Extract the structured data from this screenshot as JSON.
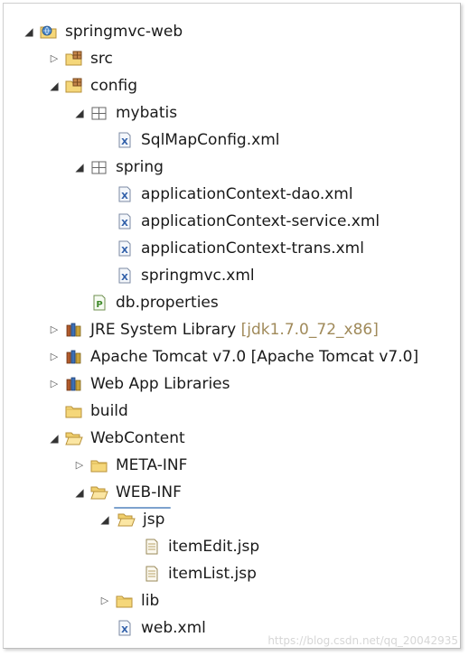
{
  "tree": {
    "items": [
      {
        "label": "springmvc-web"
      },
      {
        "label": "src"
      },
      {
        "label": "config"
      },
      {
        "label": "mybatis"
      },
      {
        "label": "SqlMapConfig.xml"
      },
      {
        "label": "spring"
      },
      {
        "label": "applicationContext-dao.xml"
      },
      {
        "label": "applicationContext-service.xml"
      },
      {
        "label": "applicationContext-trans.xml"
      },
      {
        "label": "springmvc.xml"
      },
      {
        "label": "db.properties"
      },
      {
        "label": "JRE System Library",
        "decoration": "[jdk1.7.0_72_x86]"
      },
      {
        "label": "Apache Tomcat v7.0 [Apache Tomcat v7.0]"
      },
      {
        "label": "Web App Libraries"
      },
      {
        "label": "build"
      },
      {
        "label": "WebContent"
      },
      {
        "label": "META-INF"
      },
      {
        "label": "WEB-INF"
      },
      {
        "label": "jsp"
      },
      {
        "label": "itemEdit.jsp"
      },
      {
        "label": "itemList.jsp"
      },
      {
        "label": "lib"
      },
      {
        "label": "web.xml"
      }
    ]
  },
  "icons": {
    "project": "java-web-project-icon",
    "source_folder": "source-folder-icon",
    "package": "package-icon",
    "xml": "xml-file-icon",
    "properties": "properties-file-icon",
    "library": "library-icon",
    "folder": "folder-icon",
    "open_folder": "open-folder-icon",
    "jsp": "jsp-file-icon"
  },
  "watermark": "https://blog.csdn.net/qq_20042935",
  "colors": {
    "selection_border": "#7da2ce",
    "folder": "#e9c15a",
    "decoration_text": "#a08a5a"
  }
}
